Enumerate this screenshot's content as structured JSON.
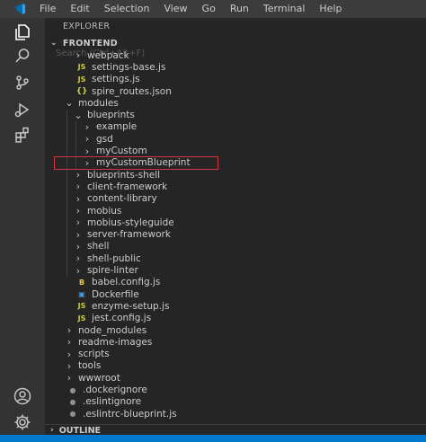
{
  "menubar": {
    "items": [
      "File",
      "Edit",
      "Selection",
      "View",
      "Go",
      "Run",
      "Terminal",
      "Help"
    ]
  },
  "activitybar": {
    "icons": [
      "explorer-icon",
      "search-icon",
      "source-control-icon",
      "run-debug-icon",
      "extensions-icon",
      "account-icon",
      "settings-gear-icon"
    ]
  },
  "sidebar": {
    "title": "EXPLORER",
    "section": "FRONTEND",
    "search_hint": "Search (Ctrl+Alt+F)",
    "outline": "OUTLINE"
  },
  "tree": [
    {
      "label": "webpack",
      "kind": "folder",
      "depth": 1,
      "expanded": false
    },
    {
      "label": "settings-base.js",
      "kind": "js",
      "depth": 1
    },
    {
      "label": "settings.js",
      "kind": "js",
      "depth": 1
    },
    {
      "label": "spire_routes.json",
      "kind": "json",
      "depth": 1
    },
    {
      "label": "modules",
      "kind": "folder",
      "depth": 0,
      "expanded": true
    },
    {
      "label": "blueprints",
      "kind": "folder",
      "depth": 1,
      "expanded": true
    },
    {
      "label": "example",
      "kind": "folder",
      "depth": 2,
      "expanded": false
    },
    {
      "label": "gsd",
      "kind": "folder",
      "depth": 2,
      "expanded": false
    },
    {
      "label": "myCustom",
      "kind": "folder",
      "depth": 2,
      "expanded": false
    },
    {
      "label": "myCustomBlueprint",
      "kind": "folder",
      "depth": 2,
      "expanded": false
    },
    {
      "label": "blueprints-shell",
      "kind": "folder",
      "depth": 1,
      "expanded": false
    },
    {
      "label": "client-framework",
      "kind": "folder",
      "depth": 1,
      "expanded": false
    },
    {
      "label": "content-library",
      "kind": "folder",
      "depth": 1,
      "expanded": false
    },
    {
      "label": "mobius",
      "kind": "folder",
      "depth": 1,
      "expanded": false
    },
    {
      "label": "mobius-styleguide",
      "kind": "folder",
      "depth": 1,
      "expanded": false
    },
    {
      "label": "server-framework",
      "kind": "folder",
      "depth": 1,
      "expanded": false
    },
    {
      "label": "shell",
      "kind": "folder",
      "depth": 1,
      "expanded": false
    },
    {
      "label": "shell-public",
      "kind": "folder",
      "depth": 1,
      "expanded": false
    },
    {
      "label": "spire-linter",
      "kind": "folder",
      "depth": 1,
      "expanded": false
    },
    {
      "label": "babel.config.js",
      "kind": "babel",
      "depth": 1
    },
    {
      "label": "Dockerfile",
      "kind": "docker",
      "depth": 1
    },
    {
      "label": "enzyme-setup.js",
      "kind": "js",
      "depth": 1
    },
    {
      "label": "jest.config.js",
      "kind": "js",
      "depth": 1
    },
    {
      "label": "node_modules",
      "kind": "folder",
      "depth": 0,
      "expanded": false
    },
    {
      "label": "readme-images",
      "kind": "folder",
      "depth": 0,
      "expanded": false
    },
    {
      "label": "scripts",
      "kind": "folder",
      "depth": 0,
      "expanded": false
    },
    {
      "label": "tools",
      "kind": "folder",
      "depth": 0,
      "expanded": false
    },
    {
      "label": "wwwroot",
      "kind": "folder",
      "depth": 0,
      "expanded": false
    },
    {
      "label": ".dockerignore",
      "kind": "dotfile",
      "depth": 0
    },
    {
      "label": ".eslintignore",
      "kind": "dotfile",
      "depth": 0
    },
    {
      "label": ".eslintrc-blueprint.js",
      "kind": "dotfile",
      "depth": 0
    }
  ],
  "highlighted_item": "myCustomBlueprint",
  "icon_glyphs": {
    "js": "JS",
    "json": "{}",
    "babel": "B",
    "docker": "▣",
    "dotfile": "●"
  },
  "colors": {
    "menubar": "#3c3c3c",
    "activitybar": "#333333",
    "sidebar": "#252526",
    "statusbar": "#007acc",
    "highlight_border": "#d0363d"
  }
}
